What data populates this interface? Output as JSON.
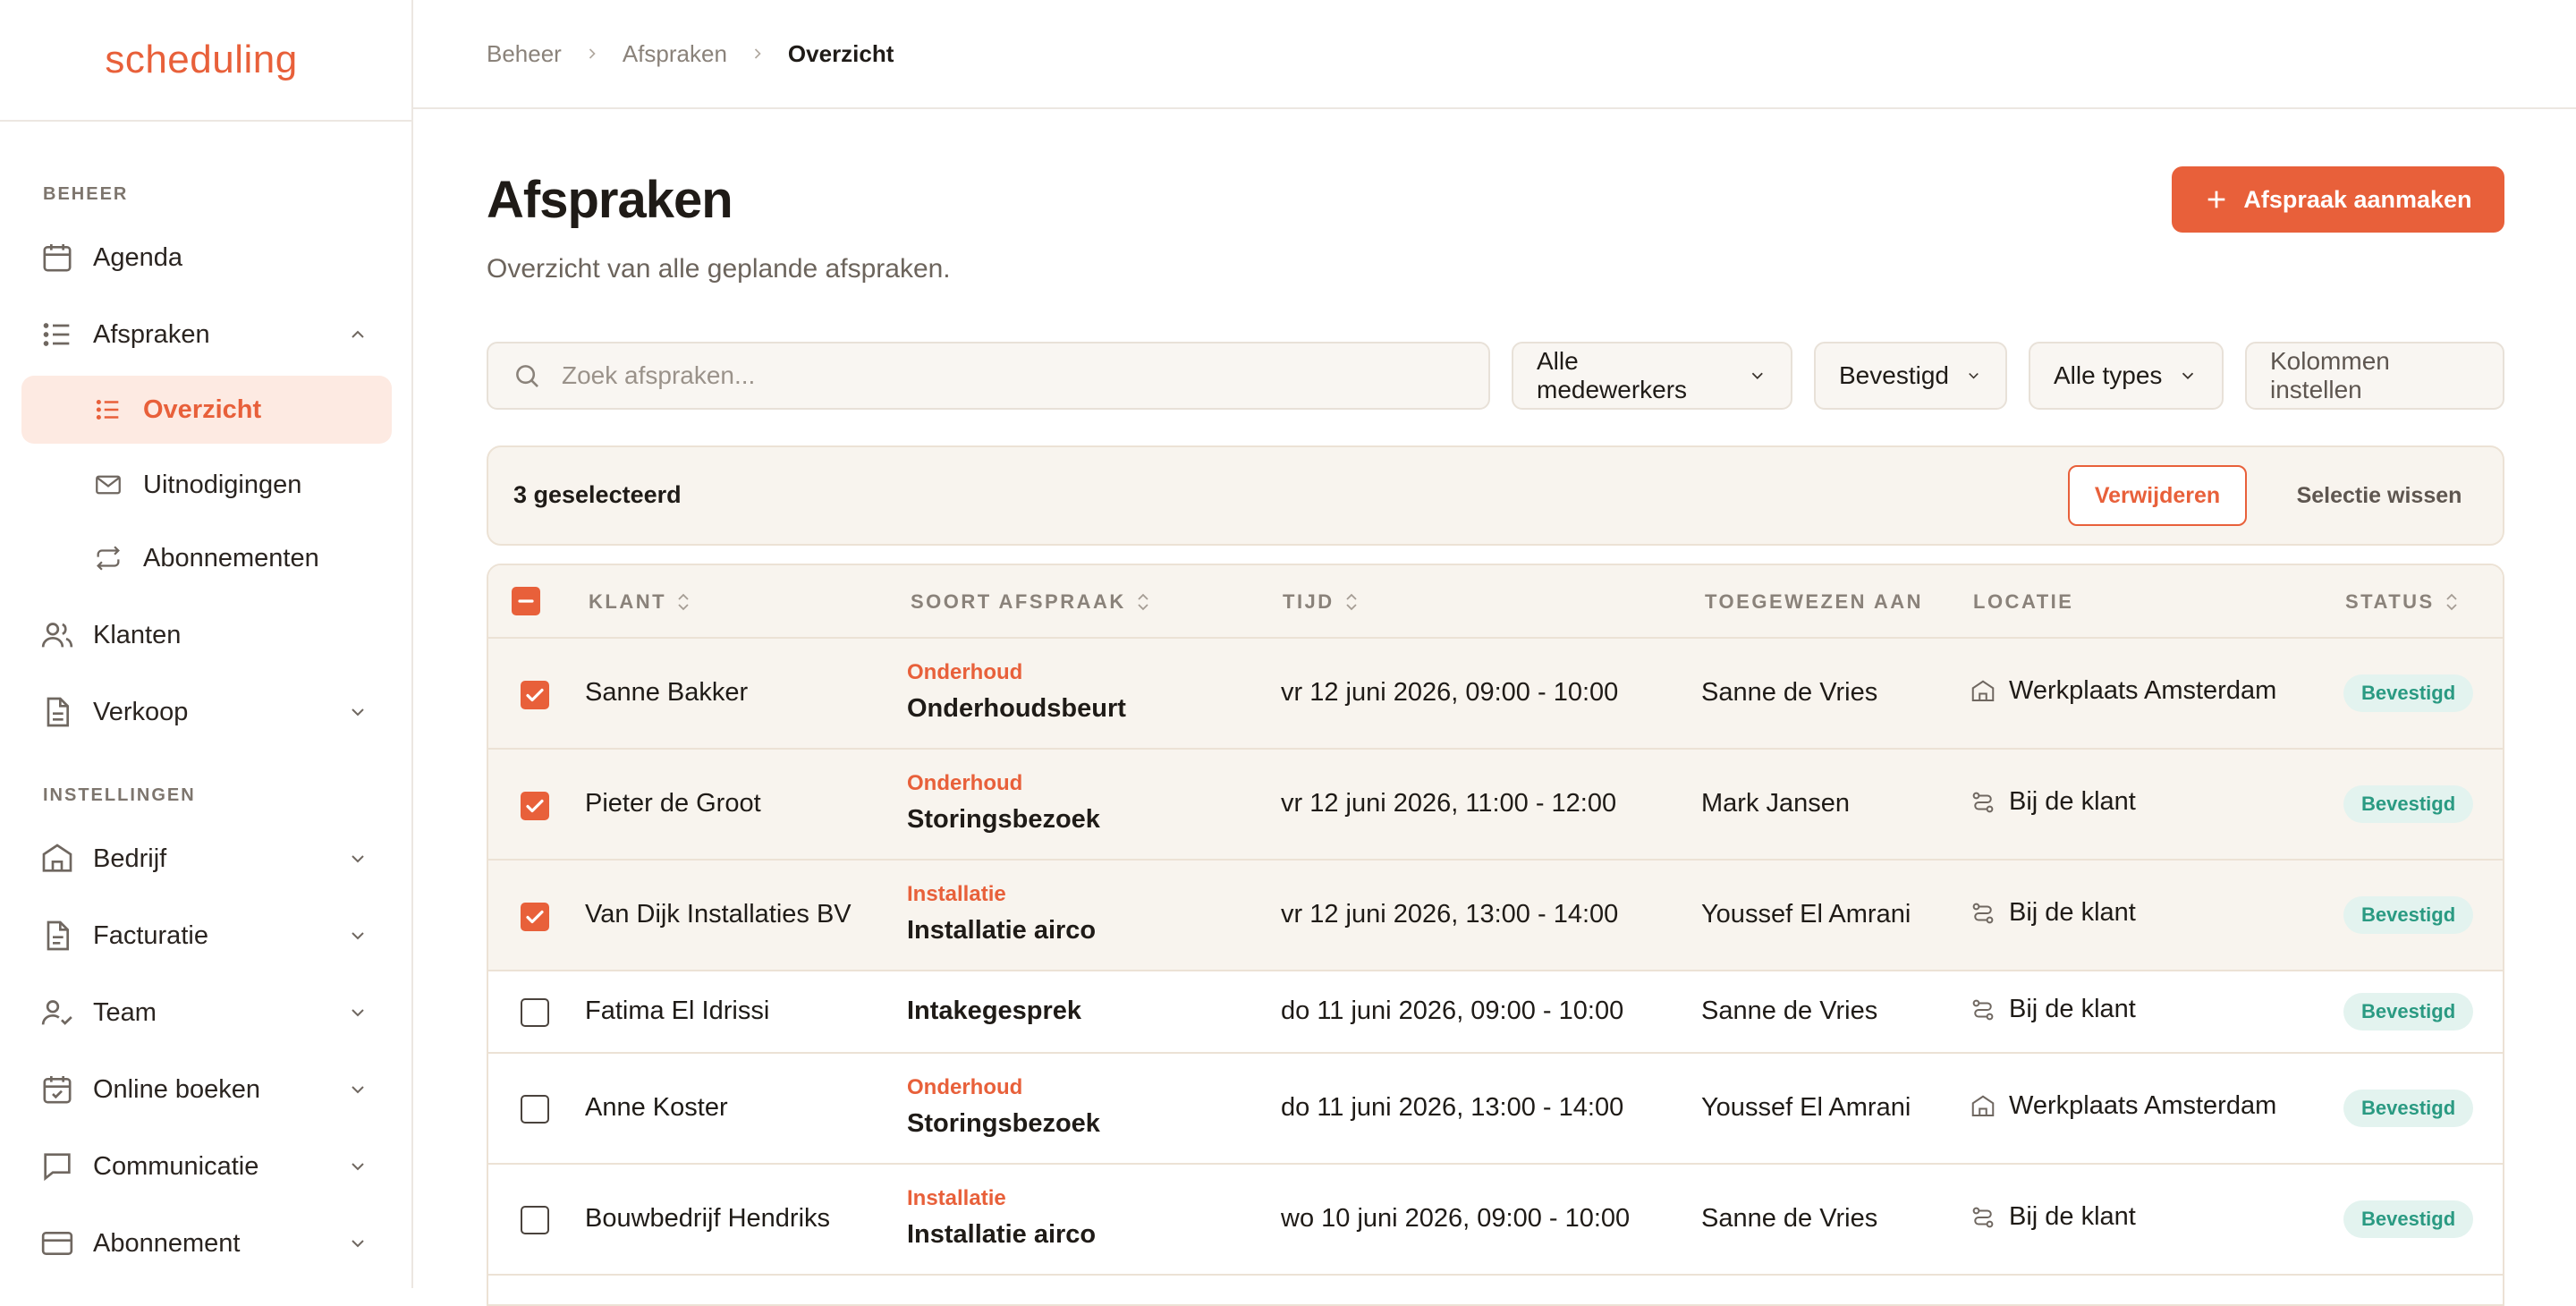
{
  "app": {
    "logo": "scheduling"
  },
  "sidebar": {
    "section_beheer": "BEHEER",
    "section_instellingen": "INSTELLINGEN",
    "items": {
      "agenda": "Agenda",
      "afspraken": "Afspraken",
      "overzicht": "Overzicht",
      "uitnodigingen": "Uitnodigingen",
      "abonnementen": "Abonnementen",
      "klanten": "Klanten",
      "verkoop": "Verkoop",
      "bedrijf": "Bedrijf",
      "facturatie": "Facturatie",
      "team": "Team",
      "online_boeken": "Online boeken",
      "communicatie": "Communicatie",
      "abonnement": "Abonnement"
    }
  },
  "breadcrumb": [
    "Beheer",
    "Afspraken",
    "Overzicht"
  ],
  "page": {
    "title": "Afspraken",
    "subtitle": "Overzicht van alle geplande afspraken.",
    "primary_button": "Afspraak aanmaken"
  },
  "filters": {
    "search_placeholder": "Zoek afspraken...",
    "medewerkers": "Alle medewerkers",
    "status": "Bevestigd",
    "types": "Alle types",
    "columns": "Kolommen instellen"
  },
  "bulk": {
    "count": "3 geselecteerd",
    "delete": "Verwijderen",
    "clear": "Selectie wissen"
  },
  "table": {
    "headers": {
      "klant": "KLANT",
      "soort": "SOORT AFSPRAAK",
      "tijd": "TIJD",
      "toegewezen": "TOEGEWEZEN AAN",
      "locatie": "LOCATIE",
      "status": "STATUS"
    },
    "rows": [
      {
        "selected": true,
        "klant": "Sanne Bakker",
        "categorie": "Onderhoud",
        "soort": "Onderhoudsbeurt",
        "tijd": "vr 12 juni 2026, 09:00 - 10:00",
        "toegewezen": "Sanne de Vries",
        "locatie_icon": "building-icon",
        "locatie": "Werkplaats Amsterdam",
        "status": "Bevestigd"
      },
      {
        "selected": true,
        "klant": "Pieter de Groot",
        "categorie": "Onderhoud",
        "soort": "Storingsbezoek",
        "tijd": "vr 12 juni 2026, 11:00 - 12:00",
        "toegewezen": "Mark Jansen",
        "locatie_icon": "route-icon",
        "locatie": "Bij de klant",
        "status": "Bevestigd"
      },
      {
        "selected": true,
        "klant": "Van Dijk Installaties BV",
        "categorie": "Installatie",
        "soort": "Installatie airco",
        "tijd": "vr 12 juni 2026, 13:00 - 14:00",
        "toegewezen": "Youssef El Amrani",
        "locatie_icon": "route-icon",
        "locatie": "Bij de klant",
        "status": "Bevestigd"
      },
      {
        "selected": false,
        "klant": "Fatima El Idrissi",
        "categorie": "",
        "soort": "Intakegesprek",
        "tijd": "do 11 juni 2026, 09:00 - 10:00",
        "toegewezen": "Sanne de Vries",
        "locatie_icon": "route-icon",
        "locatie": "Bij de klant",
        "status": "Bevestigd"
      },
      {
        "selected": false,
        "klant": "Anne Koster",
        "categorie": "Onderhoud",
        "soort": "Storingsbezoek",
        "tijd": "do 11 juni 2026, 13:00 - 14:00",
        "toegewezen": "Youssef El Amrani",
        "locatie_icon": "building-icon",
        "locatie": "Werkplaats Amsterdam",
        "status": "Bevestigd"
      },
      {
        "selected": false,
        "klant": "Bouwbedrijf Hendriks",
        "categorie": "Installatie",
        "soort": "Installatie airco",
        "tijd": "wo 10 juni 2026, 09:00 - 10:00",
        "toegewezen": "Sanne de Vries",
        "locatie_icon": "route-icon",
        "locatie": "Bij de klant",
        "status": "Bevestigd"
      }
    ]
  },
  "colors": {
    "accent": "#e8603a",
    "badge_bg": "#e3f3ef",
    "badge_text": "#2a9a82",
    "selected_row": "#f8f4ee"
  }
}
